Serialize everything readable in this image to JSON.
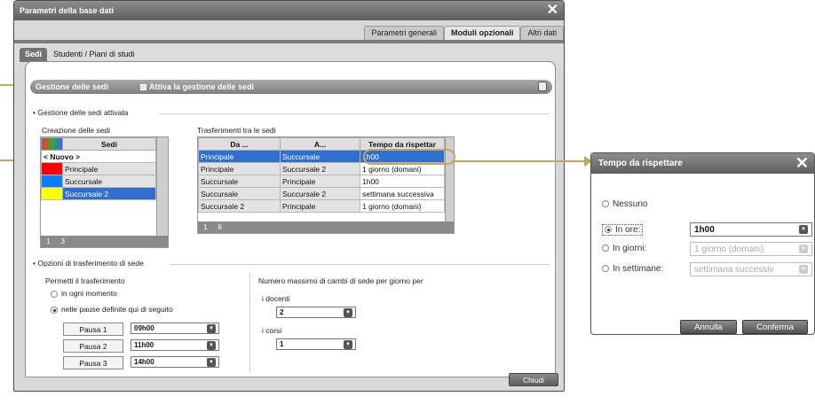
{
  "window": {
    "title": "Parametri della base dati",
    "tabs": [
      "Parametri generali",
      "Moduli opzionali",
      "Altri dati"
    ],
    "active_tab": "Moduli opzionali",
    "subtabs": [
      "Sedi",
      "Studenti / Piani di studi"
    ],
    "active_subtab": "Sedi",
    "group_bar": {
      "label": "Gestione delle sedi",
      "checkbox_label": "Attiva la gestione delle sedi"
    },
    "section1_title": "Gestione delle sedi attivata",
    "creazione": {
      "label": "Creazione delle sedi",
      "header": "Sedi",
      "new_row": "< Nuovo >",
      "rows": [
        {
          "name": "Principale",
          "color": "#ff0000"
        },
        {
          "name": "Succursale",
          "color": "#0a7cff"
        },
        {
          "name": "Succursale 2",
          "color": "#ffff00"
        }
      ],
      "footer": [
        "1",
        "3"
      ]
    },
    "trasferimenti": {
      "label": "Trasferimenti tra le sedi",
      "headers": [
        "Da ...",
        "A...",
        "Tempo da rispettar"
      ],
      "rows": [
        [
          "Principale",
          "Succursale",
          "1h00"
        ],
        [
          "Principale",
          "Succursale 2",
          "1 giorno (domani)"
        ],
        [
          "Succursale",
          "Principale",
          "1h00"
        ],
        [
          "Succursale",
          "Succursale 2",
          "settimana successiva"
        ],
        [
          "Succursale 2",
          "Principale",
          "1 giorno (domani)"
        ]
      ],
      "footer": [
        "1",
        "6"
      ]
    },
    "section2_title": "Opzioni di trasferimento di sede",
    "permetti": {
      "label": "Permetti il trasferimento",
      "opt1": "in ogni momento",
      "opt2": "nelle pause definite qui di seguito",
      "pauses": [
        {
          "label": "Pausa 1",
          "value": "09h00"
        },
        {
          "label": "Pausa 2",
          "value": "11h00"
        },
        {
          "label": "Pausa 3",
          "value": "14h00"
        }
      ]
    },
    "numero": {
      "label": "Numero massimo di cambi di sede per giorno per",
      "docenti_label": "i docenti",
      "docenti_value": "2",
      "corsi_label": "i corsi",
      "corsi_value": "1"
    },
    "close_label": "Chiudi"
  },
  "dialog": {
    "title": "Tempo da rispettare",
    "opt_none": "Nessuno",
    "opt_hours": "In ore:",
    "hours_value": "1h00",
    "opt_days": "In giorni:",
    "days_value": "1 giorno (domani)",
    "opt_weeks": "In settimane:",
    "weeks_value": "settimana successiv",
    "cancel_label": "Annulla",
    "confirm_label": "Conferma"
  },
  "colors": {
    "accent": "#c8a458",
    "selection": "#2f6fd0",
    "titlebar": "#6e6e6e"
  }
}
